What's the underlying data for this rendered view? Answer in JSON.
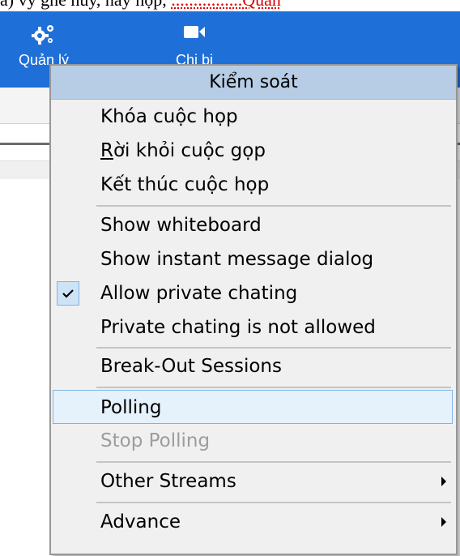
{
  "document_text": {
    "plain": "ả) vý ghe hủy, hây hộp, ",
    "red": "................Quản"
  },
  "ribbon": {
    "manage_label": "Quản lý",
    "device_label": "Chị bị",
    "icons": {
      "manage": "gears-icon",
      "device": "video-camera-icon"
    },
    "color": "#1f6fd8"
  },
  "menu": {
    "header": "Kiểm soát",
    "items": [
      {
        "label": "Khóa cuộc họp"
      },
      {
        "label": "Rời khỏi cuộc gọp",
        "mnemonic": "R"
      },
      {
        "label": "Kết thúc cuộc họp"
      },
      {
        "label": "Show whiteboard"
      },
      {
        "label": "Show instant message dialog"
      },
      {
        "label": "Allow private chating",
        "checked": true
      },
      {
        "label": "Private chating is not allowed"
      },
      {
        "label": "Break-Out Sessions"
      },
      {
        "label": "Polling",
        "highlighted": true
      },
      {
        "label": "Stop Polling",
        "disabled": true
      },
      {
        "label": "Other Streams",
        "submenu": true
      },
      {
        "label": "Advance",
        "submenu": true
      }
    ],
    "colors": {
      "header_bg": "#b7cde6",
      "highlight_bg": "#e5f1fb",
      "highlight_border": "#7fb4e7",
      "disabled_text": "#9d9d9d"
    }
  }
}
